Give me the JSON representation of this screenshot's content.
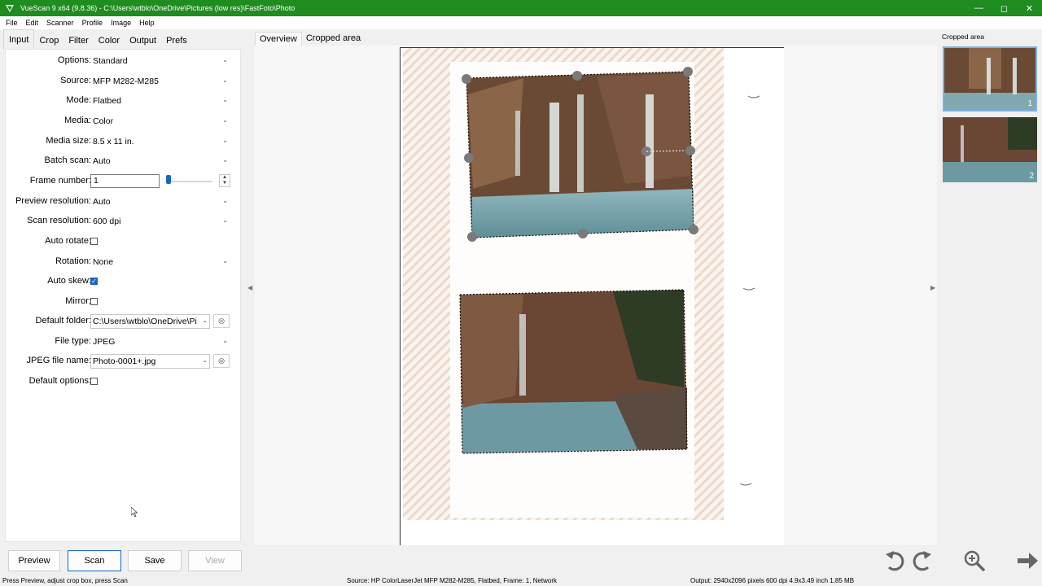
{
  "titlebar": {
    "title": "VueScan 9 x64 (9.8.36) - C:\\Users\\wtblo\\OneDrive\\Pictures (low res)\\FastFoto\\Photo"
  },
  "menu": [
    "File",
    "Edit",
    "Scanner",
    "Profile",
    "Image",
    "Help"
  ],
  "tabs": [
    "Input",
    "Crop",
    "Filter",
    "Color",
    "Output",
    "Prefs"
  ],
  "fields": {
    "options": {
      "label": "Options:",
      "value": "Standard"
    },
    "source": {
      "label": "Source:",
      "value": "MFP M282-M285"
    },
    "mode": {
      "label": "Mode:",
      "value": "Flatbed"
    },
    "media": {
      "label": "Media:",
      "value": "Color"
    },
    "media_size": {
      "label": "Media size:",
      "value": "8.5 x 11 in."
    },
    "batch_scan": {
      "label": "Batch scan:",
      "value": "Auto"
    },
    "frame_number": {
      "label": "Frame number:",
      "value": "1"
    },
    "preview_resolution": {
      "label": "Preview resolution:",
      "value": "Auto"
    },
    "scan_resolution": {
      "label": "Scan resolution:",
      "value": "600 dpi"
    },
    "auto_rotate": {
      "label": "Auto rotate:",
      "checked": false
    },
    "rotation": {
      "label": "Rotation:",
      "value": "None"
    },
    "auto_skew": {
      "label": "Auto skew:",
      "checked": true
    },
    "mirror": {
      "label": "Mirror:",
      "checked": false
    },
    "default_folder": {
      "label": "Default folder:",
      "value": "C:\\Users\\wtblo\\OneDrive\\Pi"
    },
    "file_type": {
      "label": "File type:",
      "value": "JPEG"
    },
    "jpeg_file_name": {
      "label": "JPEG file name:",
      "value": "Photo-0001+.jpg"
    },
    "default_options": {
      "label": "Default options:",
      "checked": false
    }
  },
  "view_tabs": [
    "Overview",
    "Cropped area"
  ],
  "right_panel": {
    "title": "Cropped area",
    "thumbs": [
      "1",
      "2"
    ]
  },
  "buttons": {
    "preview": "Preview",
    "scan": "Scan",
    "save": "Save",
    "view": "View"
  },
  "tools": [
    "rotate-left-icon",
    "rotate-right-icon",
    "zoom-in-icon",
    "next-arrow-icon"
  ],
  "status": {
    "left": "Press Preview, adjust crop box, press Scan",
    "middle": "Source: HP ColorLaserJet MFP M282-M285, Flatbed, Frame: 1, Network",
    "right": "Output: 2940x2096 pixels 600 dpi 4.9x3.49 inch 1.85 MB"
  },
  "colors": {
    "titlebar": "#1e8c1e",
    "accent": "#1a66c0",
    "handle": "#7a7a7a"
  }
}
